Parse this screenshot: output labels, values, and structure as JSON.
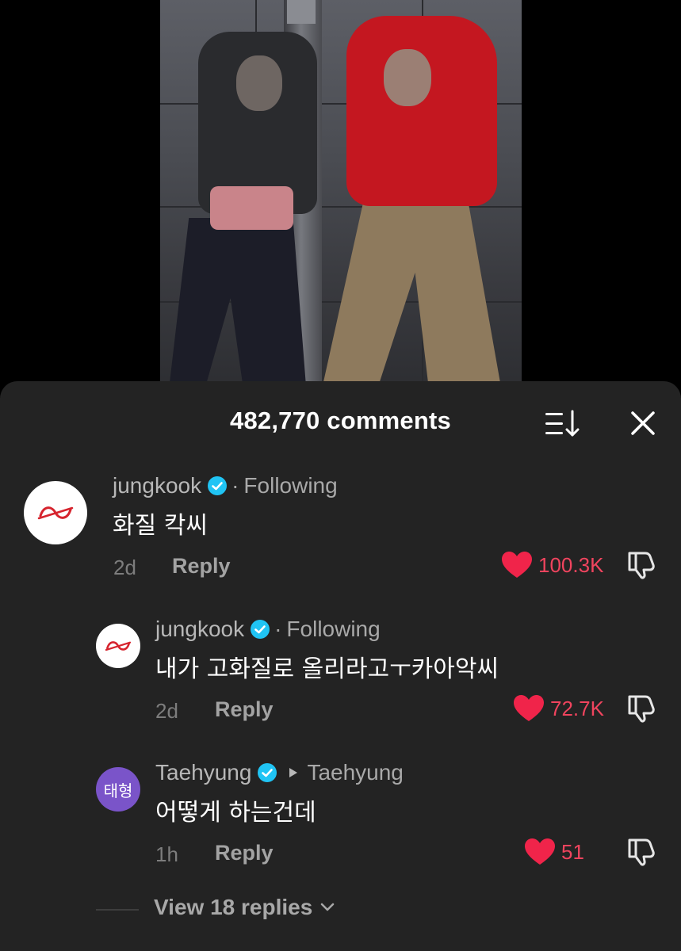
{
  "video": {
    "description_icon": "video-thumbnail"
  },
  "sheet": {
    "title": "482,770 comments",
    "sort_icon": "sort-icon",
    "close_icon": "close-icon"
  },
  "comments": [
    {
      "avatar_icon": "brand-logo-icon",
      "username": "jungkook",
      "verified": true,
      "relation": "Following",
      "separator": "·",
      "text": "화질 칵씨",
      "time": "2d",
      "reply_label": "Reply",
      "likes": "100.3K"
    },
    {
      "avatar_icon": "brand-logo-icon",
      "username": "jungkook",
      "verified": true,
      "relation": "Following",
      "separator": "·",
      "text": "내가 고화질로 올리라고ㅜ카아악씨",
      "time": "2d",
      "reply_label": "Reply",
      "likes": "72.7K"
    },
    {
      "avatar_text": "태형",
      "username": "Taehyung",
      "verified": true,
      "reply_to": "Taehyung",
      "text": "어떻게 하는건데",
      "time": "1h",
      "reply_label": "Reply",
      "likes": "51"
    }
  ],
  "view_replies": {
    "label": "View 18 replies"
  },
  "colors": {
    "sheet_bg": "#232323",
    "like_red": "#f0445e",
    "verified_blue": "#20c4f4",
    "avatar_purple": "#7a54c9"
  }
}
